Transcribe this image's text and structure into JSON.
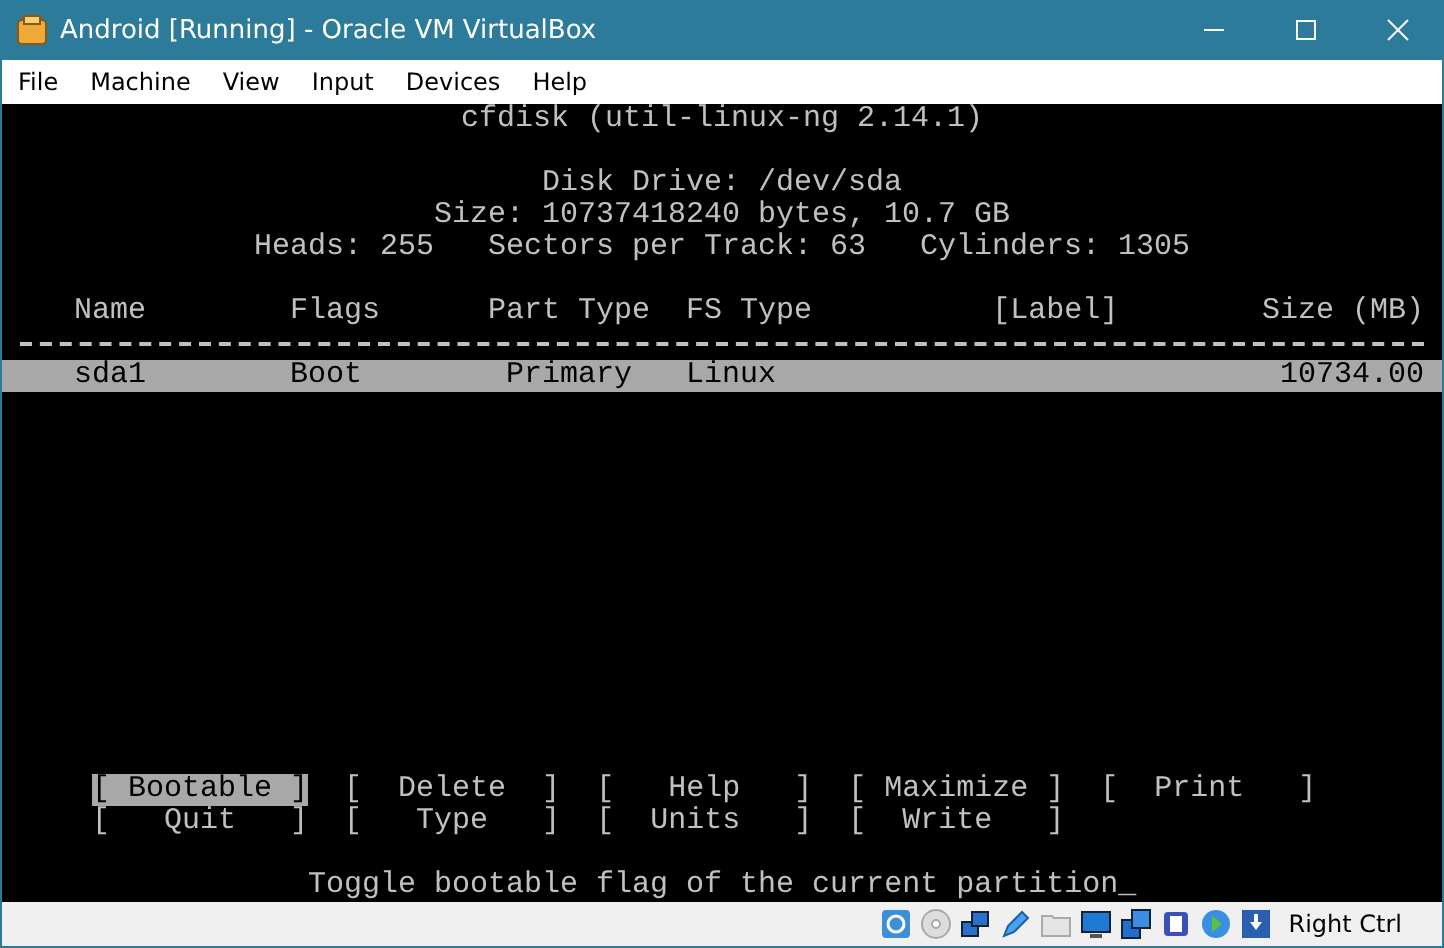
{
  "window": {
    "title": "Android [Running] - Oracle VM VirtualBox"
  },
  "menu": [
    "File",
    "Machine",
    "View",
    "Input",
    "Devices",
    "Help"
  ],
  "terminal": {
    "heading": "cfdisk (util-linux-ng 2.14.1)",
    "disk_info": [
      "Disk Drive: /dev/sda",
      "Size: 10737418240 bytes, 10.7 GB",
      "Heads: 255   Sectors per Track: 63   Cylinders: 1305"
    ],
    "columns": [
      "Name",
      "Flags",
      "Part Type",
      "FS Type",
      "[Label]",
      "Size (MB)"
    ],
    "rows": [
      {
        "selected": true,
        "cells": [
          "sda1",
          "Boot",
          "Primary",
          "Linux",
          "",
          "10734.00"
        ]
      }
    ],
    "button_rows": [
      [
        {
          "label": "[ Bootable ]",
          "selected": true
        },
        {
          "label": "[  Delete  ]",
          "selected": false
        },
        {
          "label": "[   Help   ]",
          "selected": false
        },
        {
          "label": "[ Maximize ]",
          "selected": false
        },
        {
          "label": "[  Print   ]",
          "selected": false
        }
      ],
      [
        {
          "label": "[   Quit   ]",
          "selected": false
        },
        {
          "label": "[   Type   ]",
          "selected": false
        },
        {
          "label": "[  Units   ]",
          "selected": false
        },
        {
          "label": "[  Write   ]",
          "selected": false
        }
      ]
    ],
    "status": "Toggle bootable flag of the current partition_"
  },
  "status_bar": {
    "host_key": "Right Ctrl"
  }
}
